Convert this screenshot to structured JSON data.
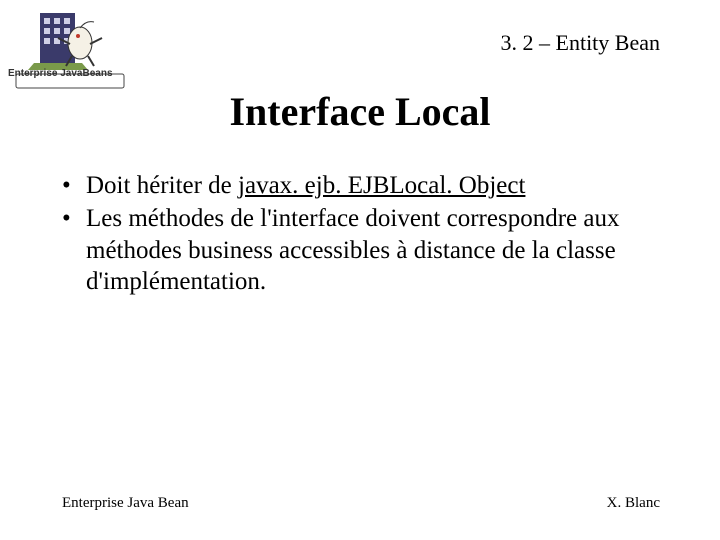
{
  "logo": {
    "caption": "Enterprise JavaBeans"
  },
  "header": {
    "section": "3. 2 – Entity Bean"
  },
  "title": "Interface Local",
  "bullets": [
    {
      "prefix": "Doit hériter de ",
      "underlined": "javax. ejb. EJBLocal. Object",
      "suffix": ""
    },
    {
      "prefix": "Les méthodes de l'interface doivent correspondre aux méthodes business accessibles à distance de la classe d'implémentation.",
      "underlined": "",
      "suffix": ""
    }
  ],
  "footer": {
    "left": "Enterprise Java Bean",
    "right": "X. Blanc"
  }
}
